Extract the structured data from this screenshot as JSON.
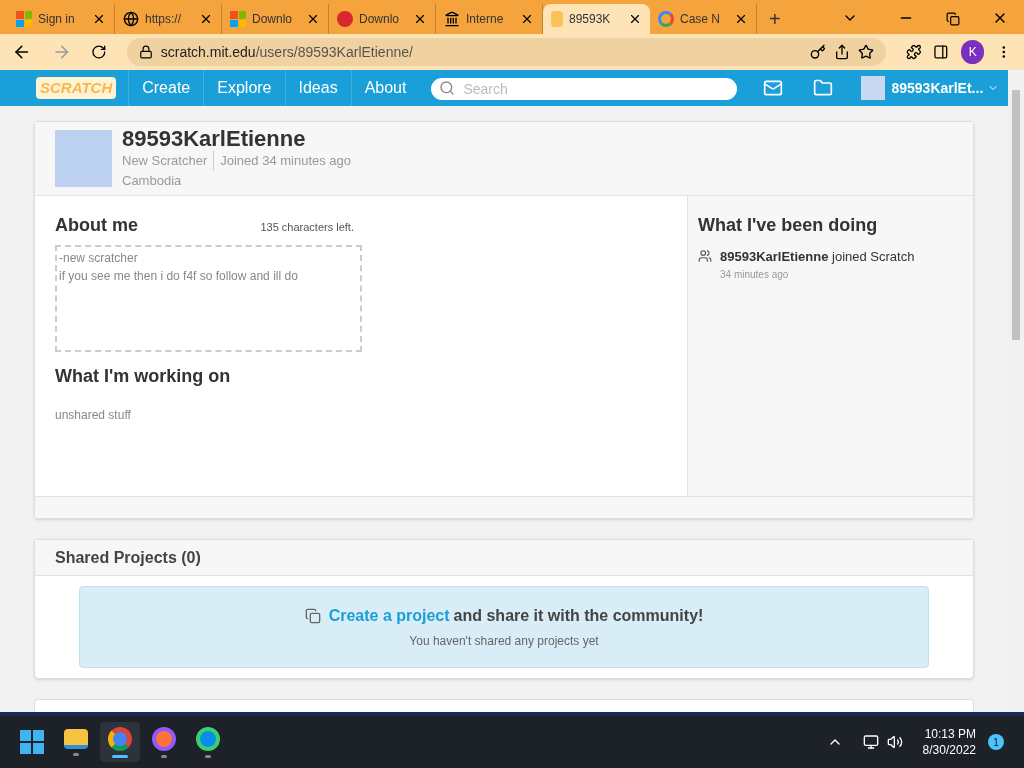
{
  "browser": {
    "tabs": [
      {
        "title": "Sign in",
        "kind": "windows",
        "selected": false
      },
      {
        "title": "https://",
        "kind": "globe",
        "selected": false
      },
      {
        "title": "Downlo",
        "kind": "windows",
        "selected": false
      },
      {
        "title": "Downlo",
        "kind": "mega",
        "selected": false
      },
      {
        "title": "Interne",
        "kind": "archive",
        "selected": false
      },
      {
        "title": "89593K",
        "kind": "scratch",
        "selected": true
      },
      {
        "title": "Case N",
        "kind": "google",
        "selected": false
      }
    ],
    "new_tab": "+",
    "url_host": "scratch.mit.edu",
    "url_path": "/users/89593KarlEtienne/",
    "profile_initial": "K"
  },
  "nav": {
    "logo": "SCRATCH",
    "links": [
      "Create",
      "Explore",
      "Ideas",
      "About"
    ],
    "search": {
      "placeholder": "Search"
    },
    "username": "89593KarlEt..."
  },
  "profile": {
    "username": "89593KarlEtienne",
    "rank": "New Scratcher",
    "joined": "Joined 34 minutes ago",
    "country": "Cambodia",
    "about": {
      "title": "About me",
      "chars_left": "135 characters left.",
      "value": "-new scratcher\nif you see me then i do f4f so follow and ill do"
    },
    "working_on": {
      "title": "What I'm working on",
      "value": "unshared stuff"
    },
    "activity": {
      "title": "What I've been doing",
      "items": [
        {
          "user": "89593KarlEtienne",
          "action": "joined Scratch",
          "time": "34 minutes ago"
        }
      ]
    }
  },
  "shared": {
    "title": "Shared Projects (0)",
    "link": "Create a project",
    "rest": "and share it with the community!",
    "note": "You haven't shared any projects yet"
  },
  "taskbar": {
    "apps": [
      {
        "kind": "files",
        "selected": false
      },
      {
        "kind": "chrome",
        "selected": true
      },
      {
        "kind": "firefox",
        "selected": false
      },
      {
        "kind": "edge",
        "selected": false
      }
    ],
    "time": "10:13 PM",
    "date": "8/30/2022",
    "badge": "1"
  }
}
